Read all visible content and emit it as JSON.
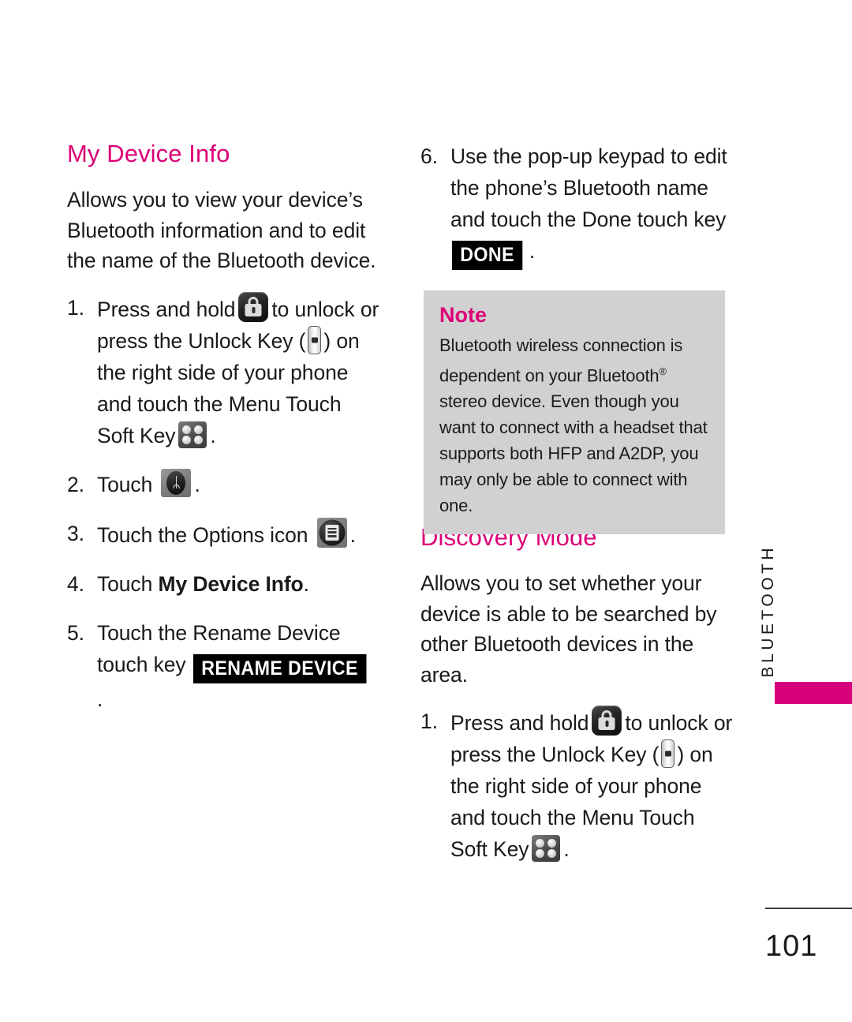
{
  "page": {
    "number": "101",
    "side_tab_label": "BLUETOOTH"
  },
  "left_column": {
    "heading": "My Device Info",
    "intro": "Allows you to view your device’s Bluetooth information and to edit the name of the Bluetooth device.",
    "steps": [
      {
        "num": "1.",
        "text_a": "Press and hold",
        "text_b": "to unlock or press the Unlock Key (",
        "text_c": ") on the right side of your phone and touch the Menu Touch Soft Key",
        "text_d": "."
      },
      {
        "num": "2.",
        "text_a": "Touch",
        "text_b": "."
      },
      {
        "num": "3.",
        "text_a": "Touch the Options icon",
        "text_b": "."
      },
      {
        "num": "4.",
        "text_a": "Touch",
        "bold": "My Device Info",
        "text_b": "."
      },
      {
        "num": "5.",
        "text_a": "Touch the Rename Device touch key",
        "key_label": "RENAME DEVICE",
        "text_b": "."
      }
    ]
  },
  "right_column": {
    "step6": {
      "num": "6.",
      "text_a": "Use the pop-up keypad to edit the phone’s Bluetooth name and touch the Done touch key",
      "key_label": "DONE",
      "text_b": "."
    },
    "note": {
      "title": "Note",
      "body_1": "Bluetooth wireless connection is dependent on your Bluetooth",
      "superscript": "®",
      "body_2": " stereo device. Even though you want to connect with a headset that supports both HFP and A2DP, you may only be able to connect with one."
    },
    "heading": "Discovery Mode",
    "intro": "Allows you to set whether your device is able to be searched by other Bluetooth devices in the area.",
    "steps": [
      {
        "num": "1.",
        "text_a": "Press and hold",
        "text_b": "to unlock or press the Unlock Key (",
        "text_c": ") on the right side of your phone and touch the Menu Touch Soft Key",
        "text_d": "."
      }
    ]
  },
  "icons": {
    "lock": "lock-icon",
    "side_key": "unlock-side-key-icon",
    "menu_soft_key": "menu-touch-soft-key-icon",
    "bluetooth": "bluetooth-icon",
    "options": "options-icon",
    "bluetooth_glyph": "ᛦ"
  },
  "colors": {
    "accent_magenta": "#DC0077",
    "tab_magenta": "#D6007C",
    "note_background": "#D1D1D1",
    "key_background": "#000000",
    "text": "#1A1A1A"
  }
}
